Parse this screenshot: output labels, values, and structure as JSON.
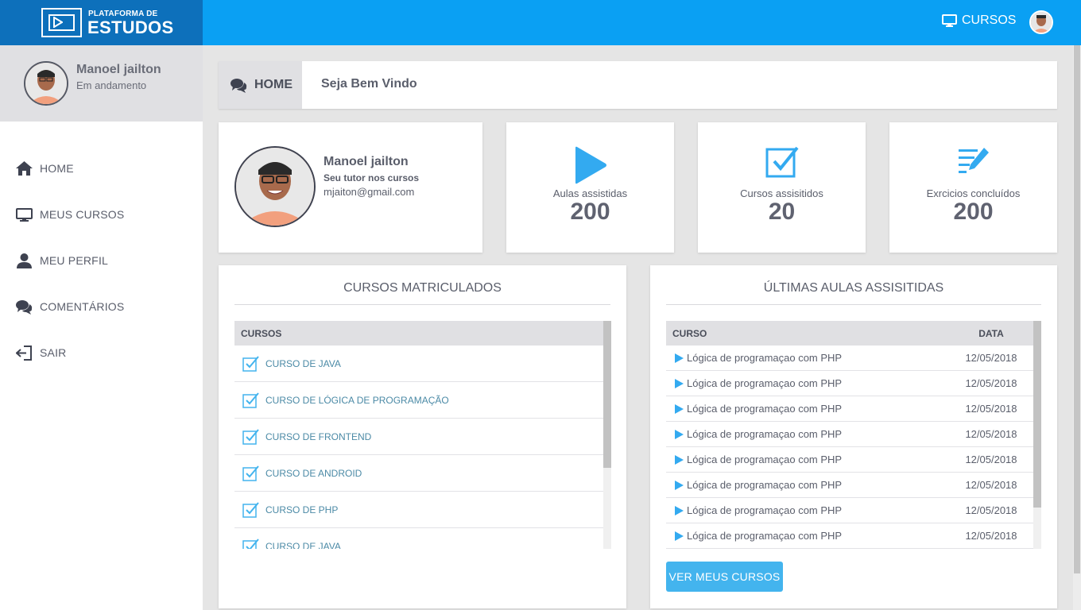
{
  "brand": {
    "small": "PLATAFORMA DE",
    "big": "ESTUDOS"
  },
  "topbar": {
    "cursos_label": "CURSOS"
  },
  "sidebar": {
    "name": "Manoel jailton",
    "status": "Em andamento",
    "items": [
      {
        "label": "HOME",
        "icon": "home-icon"
      },
      {
        "label": "MEUS CURSOS",
        "icon": "monitor-icon"
      },
      {
        "label": "MEU PERFIL",
        "icon": "user-icon"
      },
      {
        "label": "COMENTÁRIOS",
        "icon": "comments-icon"
      },
      {
        "label": "SAIR",
        "icon": "sign-out-icon"
      }
    ]
  },
  "header": {
    "home_label": "HOME",
    "title": "Seja Bem Vindo"
  },
  "profile": {
    "name": "Manoel jailton",
    "subtitle": "Seu tutor nos cursos",
    "email": "mjaiton@gmail.com"
  },
  "stats": [
    {
      "label": "Aulas assistidas",
      "value": "200",
      "icon": "play-icon"
    },
    {
      "label": "Cursos assisitidos",
      "value": "20",
      "icon": "checkbox-icon"
    },
    {
      "label": "Exrcicios concluídos",
      "value": "200",
      "icon": "edit-list-icon"
    }
  ],
  "cursos": {
    "title": "CURSOS MATRICULADOS",
    "header": "CURSOS",
    "rows": [
      "CURSO DE JAVA",
      "CURSO DE LÓGICA DE PROGRAMAÇÃO",
      "CURSO DE FRONTEND",
      "CURSO DE ANDROID",
      "CURSO DE PHP",
      "CURSO DE JAVA"
    ]
  },
  "aulas": {
    "title": "ÚLTIMAS AULAS ASSISITIDAS",
    "col_curso": "CURSO",
    "col_data": "DATA",
    "rows": [
      {
        "name": "Lógica de programaçao com PHP",
        "date": "12/05/2018"
      },
      {
        "name": "Lógica de programaçao com PHP",
        "date": "12/05/2018"
      },
      {
        "name": "Lógica de programaçao com PHP",
        "date": "12/05/2018"
      },
      {
        "name": "Lógica de programaçao com PHP",
        "date": "12/05/2018"
      },
      {
        "name": "Lógica de programaçao com PHP",
        "date": "12/05/2018"
      },
      {
        "name": "Lógica de programaçao com PHP",
        "date": "12/05/2018"
      },
      {
        "name": "Lógica de programaçao com PHP",
        "date": "12/05/2018"
      },
      {
        "name": "Lógica de programaçao com PHP",
        "date": "12/05/2018"
      }
    ],
    "button_label": "VER MEUS CURSOS"
  },
  "colors": {
    "topbar": "#0aa0f3",
    "logo_bg": "#0d70bb",
    "accent": "#33aaf0",
    "button": "#43b4ee",
    "link": "#4b8aa6"
  }
}
